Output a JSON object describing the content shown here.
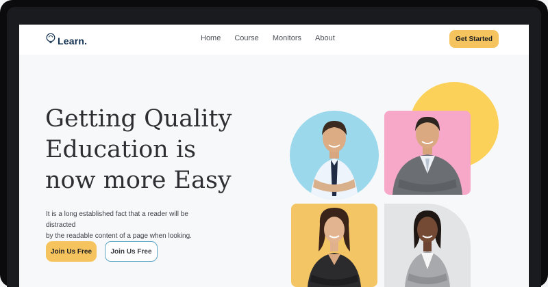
{
  "nav": {
    "logo_text": "Learn.",
    "logo_icon": "lightbulb-icon",
    "items": [
      "Home",
      "Course",
      "Monitors",
      "About"
    ],
    "cta_label": "Get Started"
  },
  "hero": {
    "title_lines": [
      "Getting Quality",
      "Education is",
      "now more Easy"
    ],
    "description_lines": [
      "It is a long established fact that a reader will be distracted",
      "by the readable content of a page when looking."
    ],
    "primary_button": "Join Us Free",
    "secondary_button": "Join Us Free"
  },
  "colors": {
    "accent": "#f6c45f",
    "brand": "#0f2e4f",
    "outline": "#5aa4c8",
    "card_blue": "#9cd8ec",
    "card_pink": "#f7a8c8",
    "card_yellow": "#f4c564",
    "card_gray": "#e3e4e6",
    "blob": "#fcd15a"
  }
}
